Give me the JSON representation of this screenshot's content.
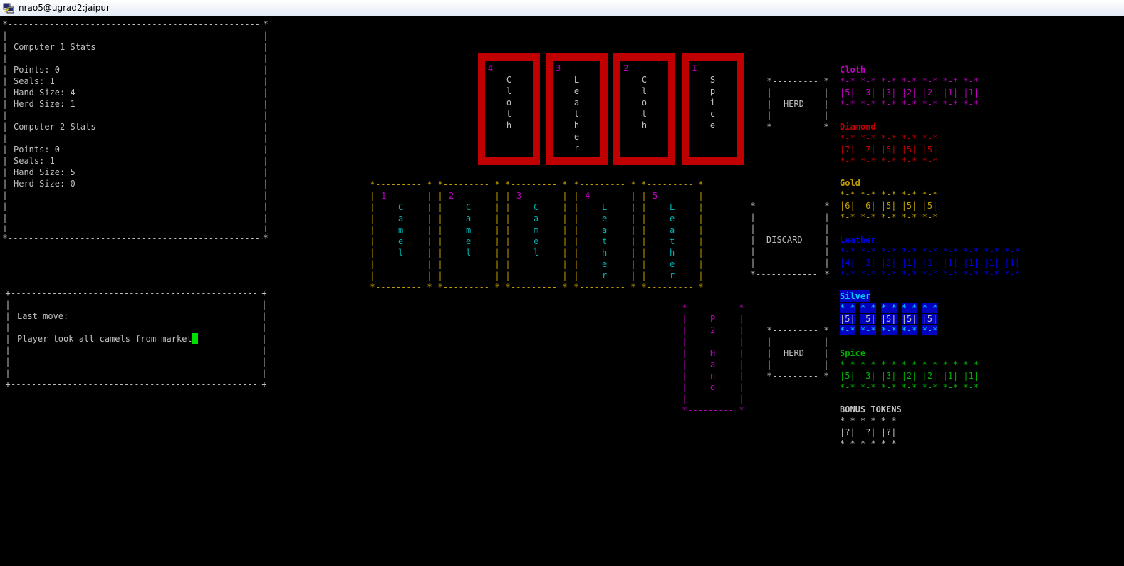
{
  "window": {
    "title": "nrao5@ugrad2:jaipur"
  },
  "stats": {
    "c1_header": "Computer 1 Stats",
    "c1_points": "Points: 0",
    "c1_seals": "Seals: 1",
    "c1_hand": "Hand Size: 4",
    "c1_herd": "Herd Size: 1",
    "c2_header": "Computer 2 Stats",
    "c2_points": "Points: 0",
    "c2_seals": "Seals: 1",
    "c2_hand": "Hand Size: 5",
    "c2_herd": "Herd Size: 0"
  },
  "lastmove": {
    "label": "Last move:",
    "text": "Player took all camels from market"
  },
  "market": [
    {
      "num": "4",
      "name": "C\nl\no\nt\nh"
    },
    {
      "num": "3",
      "name": "L\ne\na\nt\nh\ne\nr"
    },
    {
      "num": "2",
      "name": "C\nl\no\nt\nh"
    },
    {
      "num": "1",
      "name": "S\np\ni\nc\ne"
    }
  ],
  "hand": [
    {
      "num": "1",
      "name": "C\na\nm\ne\nl"
    },
    {
      "num": "2",
      "name": "C\na\nm\ne\nl"
    },
    {
      "num": "3",
      "name": "C\na\nm\ne\nl"
    },
    {
      "num": "4",
      "name": "L\ne\na\nt\nh\ne\nr"
    },
    {
      "num": "5",
      "name": "L\ne\na\nt\nh\ne\nr"
    }
  ],
  "piles": {
    "herd_top": "HERD",
    "discard": "DISCARD",
    "herd_bottom": "HERD",
    "p2_hand": "P\n2\n \nH\na\nn\nd"
  },
  "tokens": {
    "cloth": {
      "label": "Cloth",
      "top": "*-* *-* *-* *-* *-* *-* *-*",
      "values": "|5| |3| |3| |2| |2| |1| |1|"
    },
    "diamond": {
      "label": "Diamond",
      "top": "*-* *-* *-* *-* *-*",
      "values": "|7| |7| |5| |5| |5|"
    },
    "gold": {
      "label": "Gold",
      "top": "*-* *-* *-* *-* *-*",
      "values": "|6| |6| |5| |5| |5|"
    },
    "leather": {
      "label": "Leather",
      "top": "*-* *-* *-* *-* *-* *-* *-* *-* *-*",
      "values": "|4| |3| |2| |1| |1| |1| |1| |1| |1|"
    },
    "silver": {
      "label": "Silver",
      "top": "*-* *-* *-* *-* *-*",
      "values": "|5| |5| |5| |5| |5|"
    },
    "spice": {
      "label": "Spice",
      "top": "*-* *-* *-* *-* *-* *-* *-*",
      "values": "|5| |3| |3| |2| |2| |1| |1|"
    },
    "bonus": {
      "label": "BONUS TOKENS",
      "top": "*-* *-* *-*",
      "values": "|?| |?| |?|"
    }
  },
  "colors": {
    "cloth": "#c000c0",
    "diamond": "#c00000",
    "gold": "#c0a000",
    "leather": "#0000e0",
    "silver": "#0000c0",
    "spice": "#00b000",
    "cursor": "#00e000"
  },
  "icons": {
    "app": "putty-icon"
  }
}
